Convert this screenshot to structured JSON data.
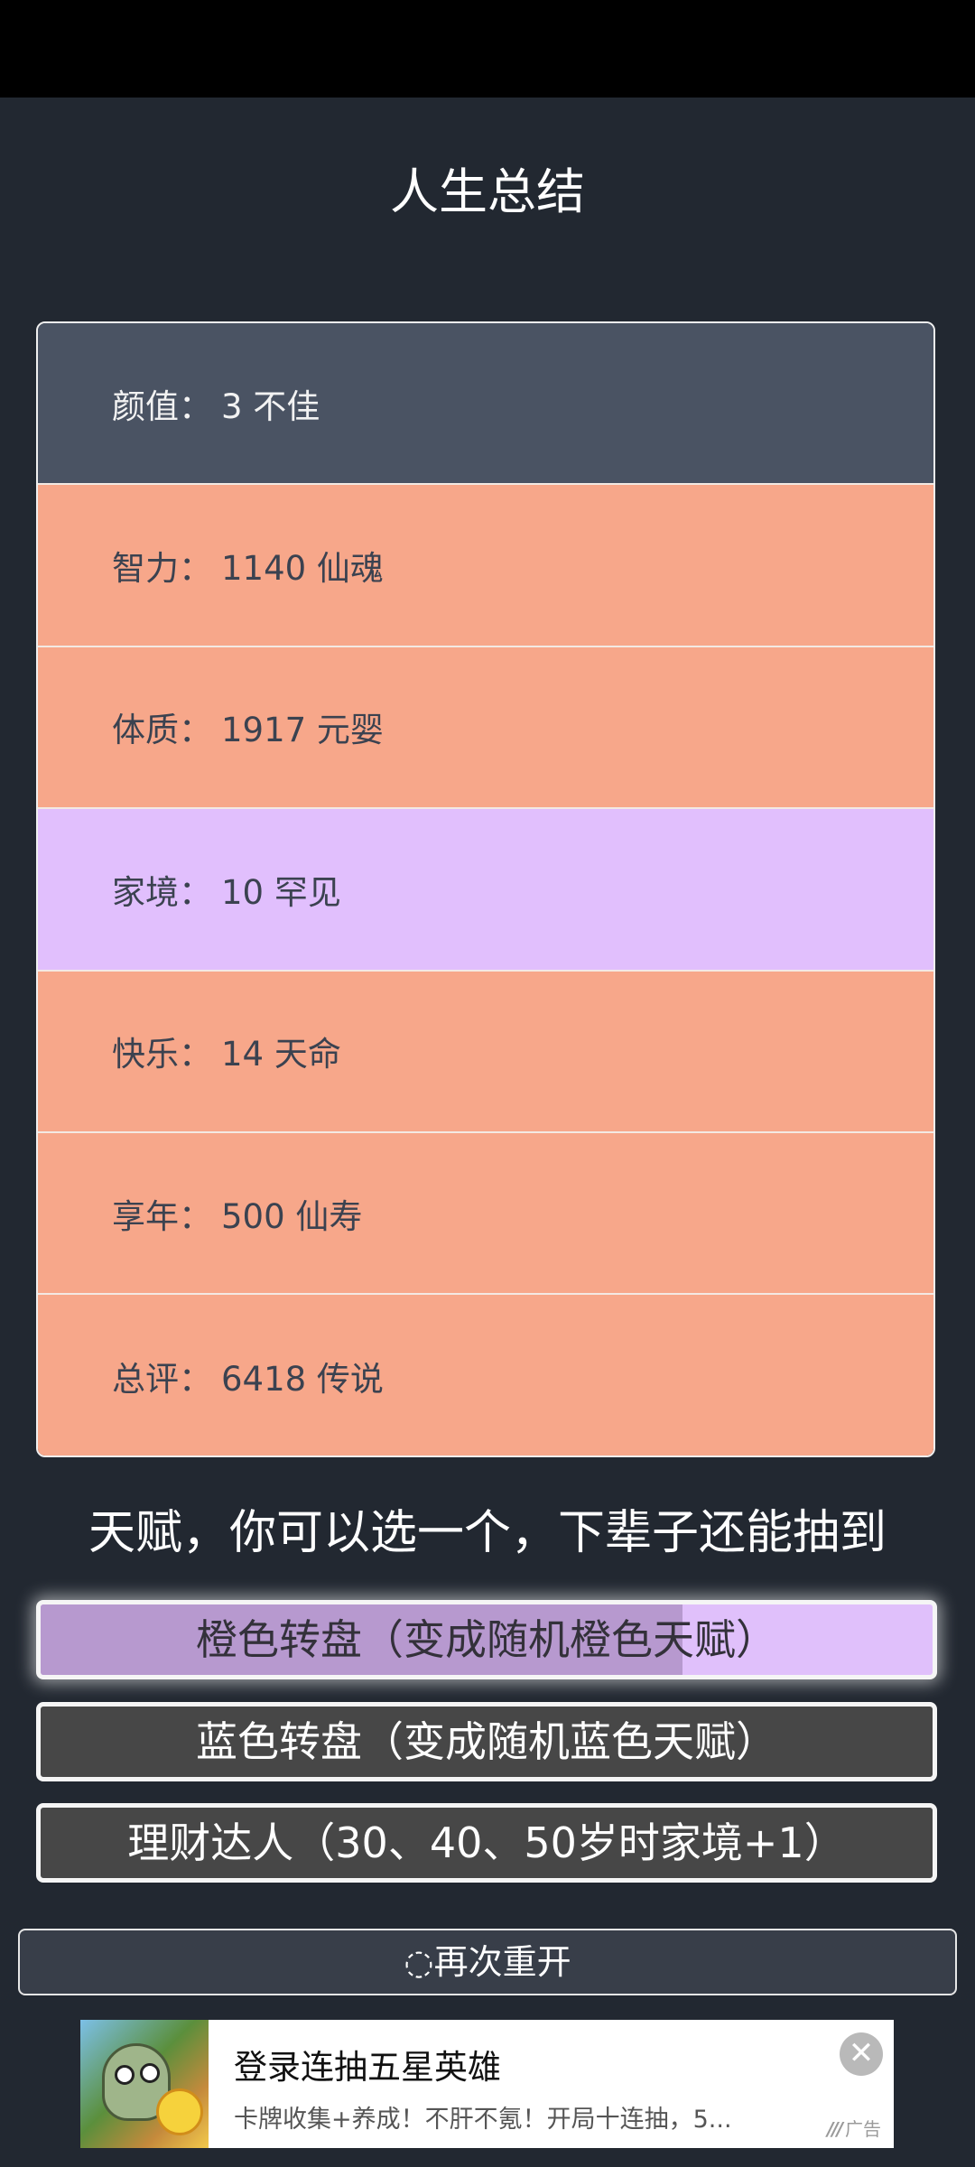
{
  "page": {
    "title": "人生总结"
  },
  "summary": {
    "separator": "：",
    "rows": [
      {
        "label": "颜值",
        "value": "3 不佳",
        "color": "#4a5363",
        "text_style": "light"
      },
      {
        "label": "智力",
        "value": "1140 仙魂",
        "color": "#f7a78a",
        "text_style": "dark"
      },
      {
        "label": "体质",
        "value": "1917 元婴",
        "color": "#f7a78a",
        "text_style": "dark"
      },
      {
        "label": "家境",
        "value": "10 罕见",
        "color": "#e1bffd",
        "text_style": "dark"
      },
      {
        "label": "快乐",
        "value": "14 天命",
        "color": "#f7a78a",
        "text_style": "dark"
      },
      {
        "label": "享年",
        "value": "500 仙寿",
        "color": "#f7a78a",
        "text_style": "dark"
      },
      {
        "label": "总评",
        "value": "6418 传说",
        "color": "#f7a78a",
        "text_style": "dark"
      }
    ]
  },
  "talents": {
    "heading": "天赋，你可以选一个，下辈子还能抽到",
    "items": [
      {
        "label": "橙色转盘（变成随机橙色天赋）",
        "selected": true,
        "progress": 0.72
      },
      {
        "label": "蓝色转盘（变成随机蓝色天赋）",
        "selected": false
      },
      {
        "label": "理财达人（30、40、50岁时家境+1）",
        "selected": false
      }
    ]
  },
  "restart": {
    "icon": "refresh-icon",
    "glyph": "◌",
    "label": "再次重开"
  },
  "ad": {
    "title": "登录连抽五星英雄",
    "description": "卡牌收集+养成！不肝不氪！开局十连抽，5...",
    "close_glyph": "✕",
    "tag_mark": "///",
    "tag": "广告"
  }
}
